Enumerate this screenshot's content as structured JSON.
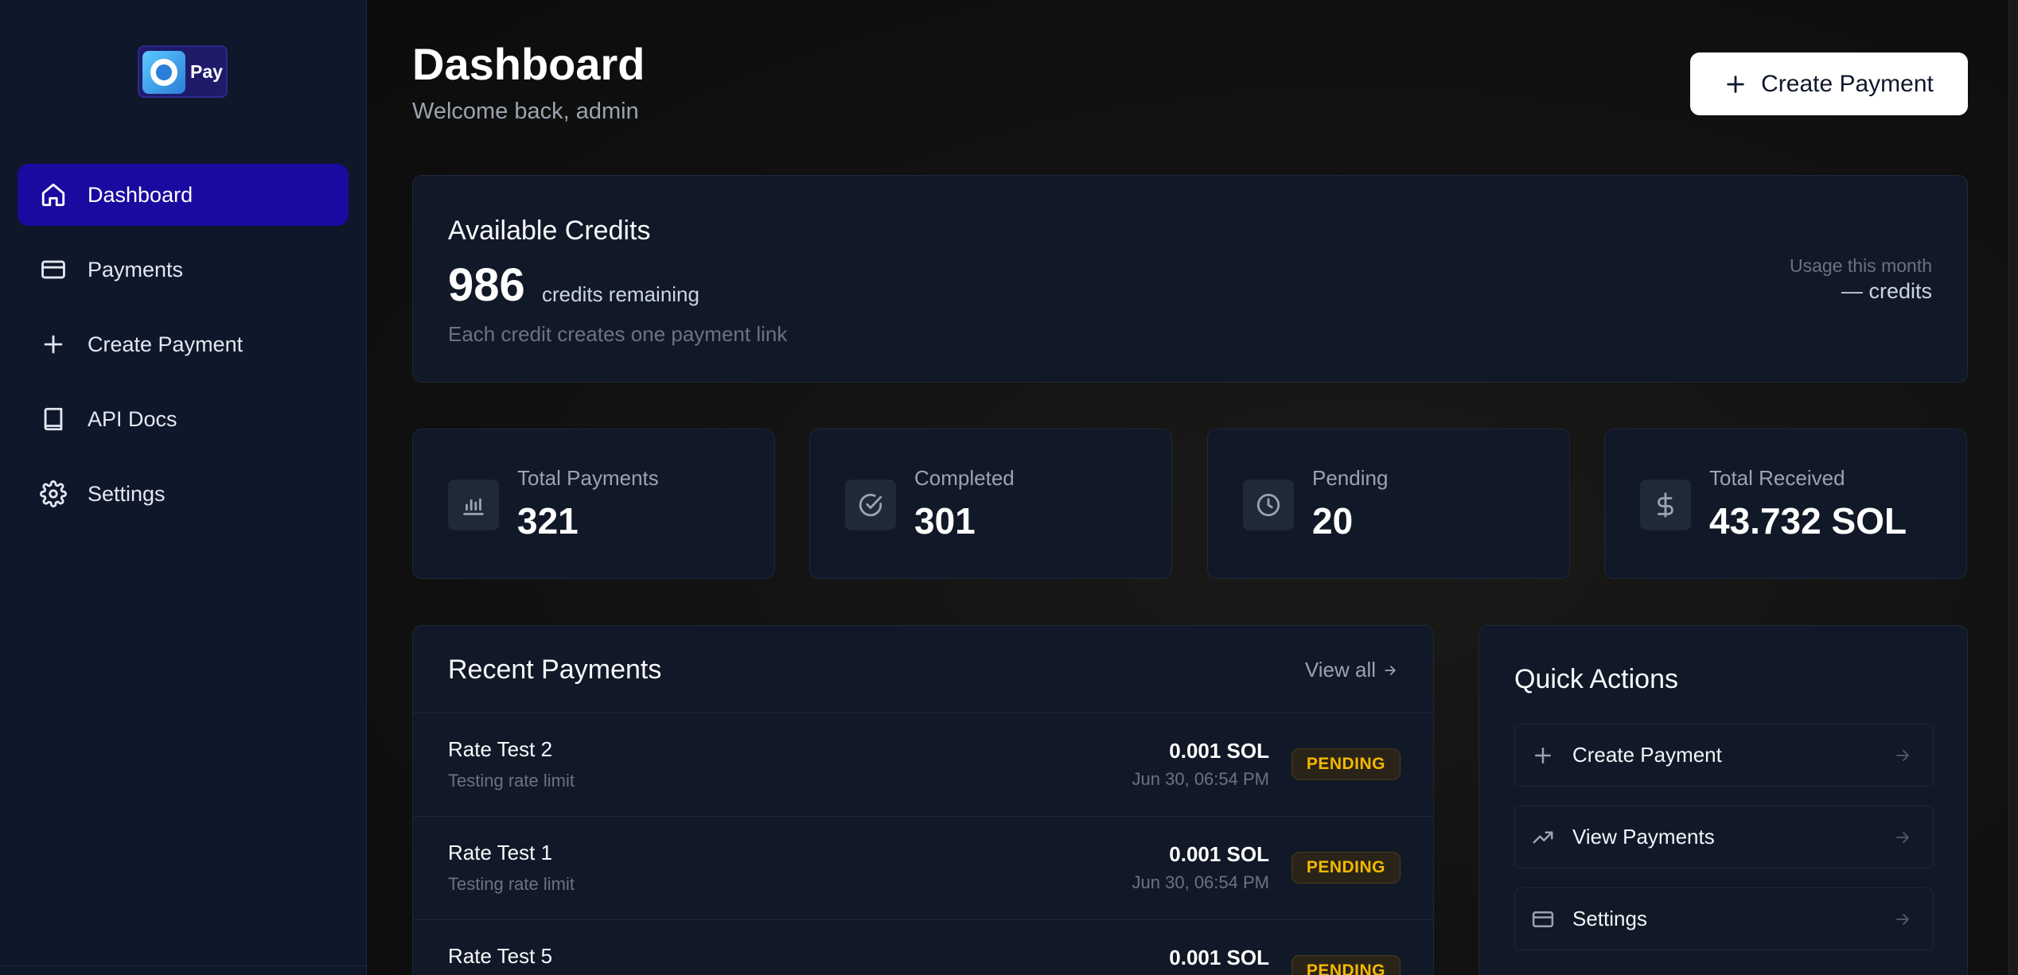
{
  "app": {
    "logo_text": "Pay"
  },
  "sidebar": {
    "items": [
      {
        "label": "Dashboard",
        "icon": "home-icon",
        "active": true
      },
      {
        "label": "Payments",
        "icon": "credit-card-icon",
        "active": false
      },
      {
        "label": "Create Payment",
        "icon": "plus-icon",
        "active": false
      },
      {
        "label": "API Docs",
        "icon": "book-icon",
        "active": false
      },
      {
        "label": "Settings",
        "icon": "gear-icon",
        "active": false
      }
    ]
  },
  "header": {
    "title": "Dashboard",
    "subtitle": "Welcome back, admin",
    "create_button_label": "Create Payment"
  },
  "credits": {
    "title": "Available Credits",
    "value": "986",
    "unit": "credits remaining",
    "note": "Each credit creates one payment link",
    "usage_label": "Usage this month",
    "usage_value": "— credits"
  },
  "stats": [
    {
      "label": "Total Payments",
      "value": "321",
      "icon": "bar-chart-icon"
    },
    {
      "label": "Completed",
      "value": "301",
      "icon": "check-circle-icon"
    },
    {
      "label": "Pending",
      "value": "20",
      "icon": "clock-icon"
    },
    {
      "label": "Total Received",
      "value": "43.732 SOL",
      "icon": "dollar-icon"
    }
  ],
  "recent": {
    "title": "Recent Payments",
    "view_all": "View all",
    "rows": [
      {
        "name": "Rate Test 2",
        "description": "Testing rate limit",
        "amount": "0.001 SOL",
        "date": "Jun 30, 06:54 PM",
        "status": "PENDING"
      },
      {
        "name": "Rate Test 1",
        "description": "Testing rate limit",
        "amount": "0.001 SOL",
        "date": "Jun 30, 06:54 PM",
        "status": "PENDING"
      },
      {
        "name": "Rate Test 5",
        "description": "",
        "amount": "0.001 SOL",
        "date": "",
        "status": "PENDING"
      }
    ]
  },
  "quick_actions": {
    "title": "Quick Actions",
    "items": [
      {
        "label": "Create Payment",
        "icon": "plus-icon"
      },
      {
        "label": "View Payments",
        "icon": "trending-up-icon"
      },
      {
        "label": "Settings",
        "icon": "credit-card-icon"
      }
    ]
  },
  "colors": {
    "accent": "#1a0aa0",
    "sidebar_bg": "#0f172a",
    "card_bg": "#111827",
    "pending": "#f5b800"
  }
}
